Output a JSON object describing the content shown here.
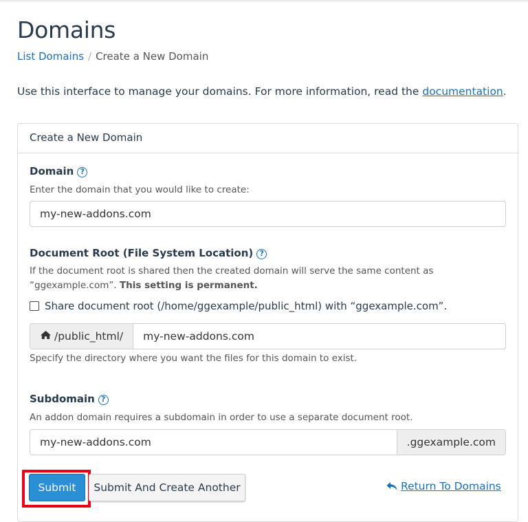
{
  "page": {
    "title": "Domains"
  },
  "breadcrumb": {
    "items": [
      "List Domains",
      "Create a New Domain"
    ],
    "separator": "/"
  },
  "intro": {
    "text": "Use this interface to manage your domains. For more information, read the ",
    "link_text": "documentation",
    "suffix": "."
  },
  "panel": {
    "heading": "Create a New Domain",
    "domain": {
      "label": "Domain",
      "hint": "Enter the domain that you would like to create:",
      "value": "my-new-addons.com"
    },
    "document_root": {
      "label": "Document Root (File System Location)",
      "hint_line1": "If the document root is shared then the created domain will serve the same content as",
      "hint_line2_prefix": "“ggexample.com”.",
      "hint_line2_bold": "This setting is permanent.",
      "share_checkbox_label": "Share document root (/home/ggexample/public_html) with “ggexample.com”.",
      "share_checked": false,
      "prefix": "/public_html/",
      "value": "my-new-addons.com",
      "help_text": "Specify the directory where you want the files for this domain to exist."
    },
    "subdomain": {
      "label": "Subdomain",
      "hint": "An addon domain requires a subdomain in order to use a separate document root.",
      "value": "my-new-addons.com",
      "suffix": ".ggexample.com"
    }
  },
  "actions": {
    "submit_label": "Submit",
    "submit_another_label": "Submit And Create Another",
    "return_label": "Return To Domains"
  },
  "colors": {
    "accent": "#2b8fd6",
    "link": "#1c6fb3",
    "highlight": "#e8001c"
  },
  "icons": {
    "help": "question-circle-icon",
    "home": "home-icon",
    "return": "reply-arrow-icon"
  }
}
